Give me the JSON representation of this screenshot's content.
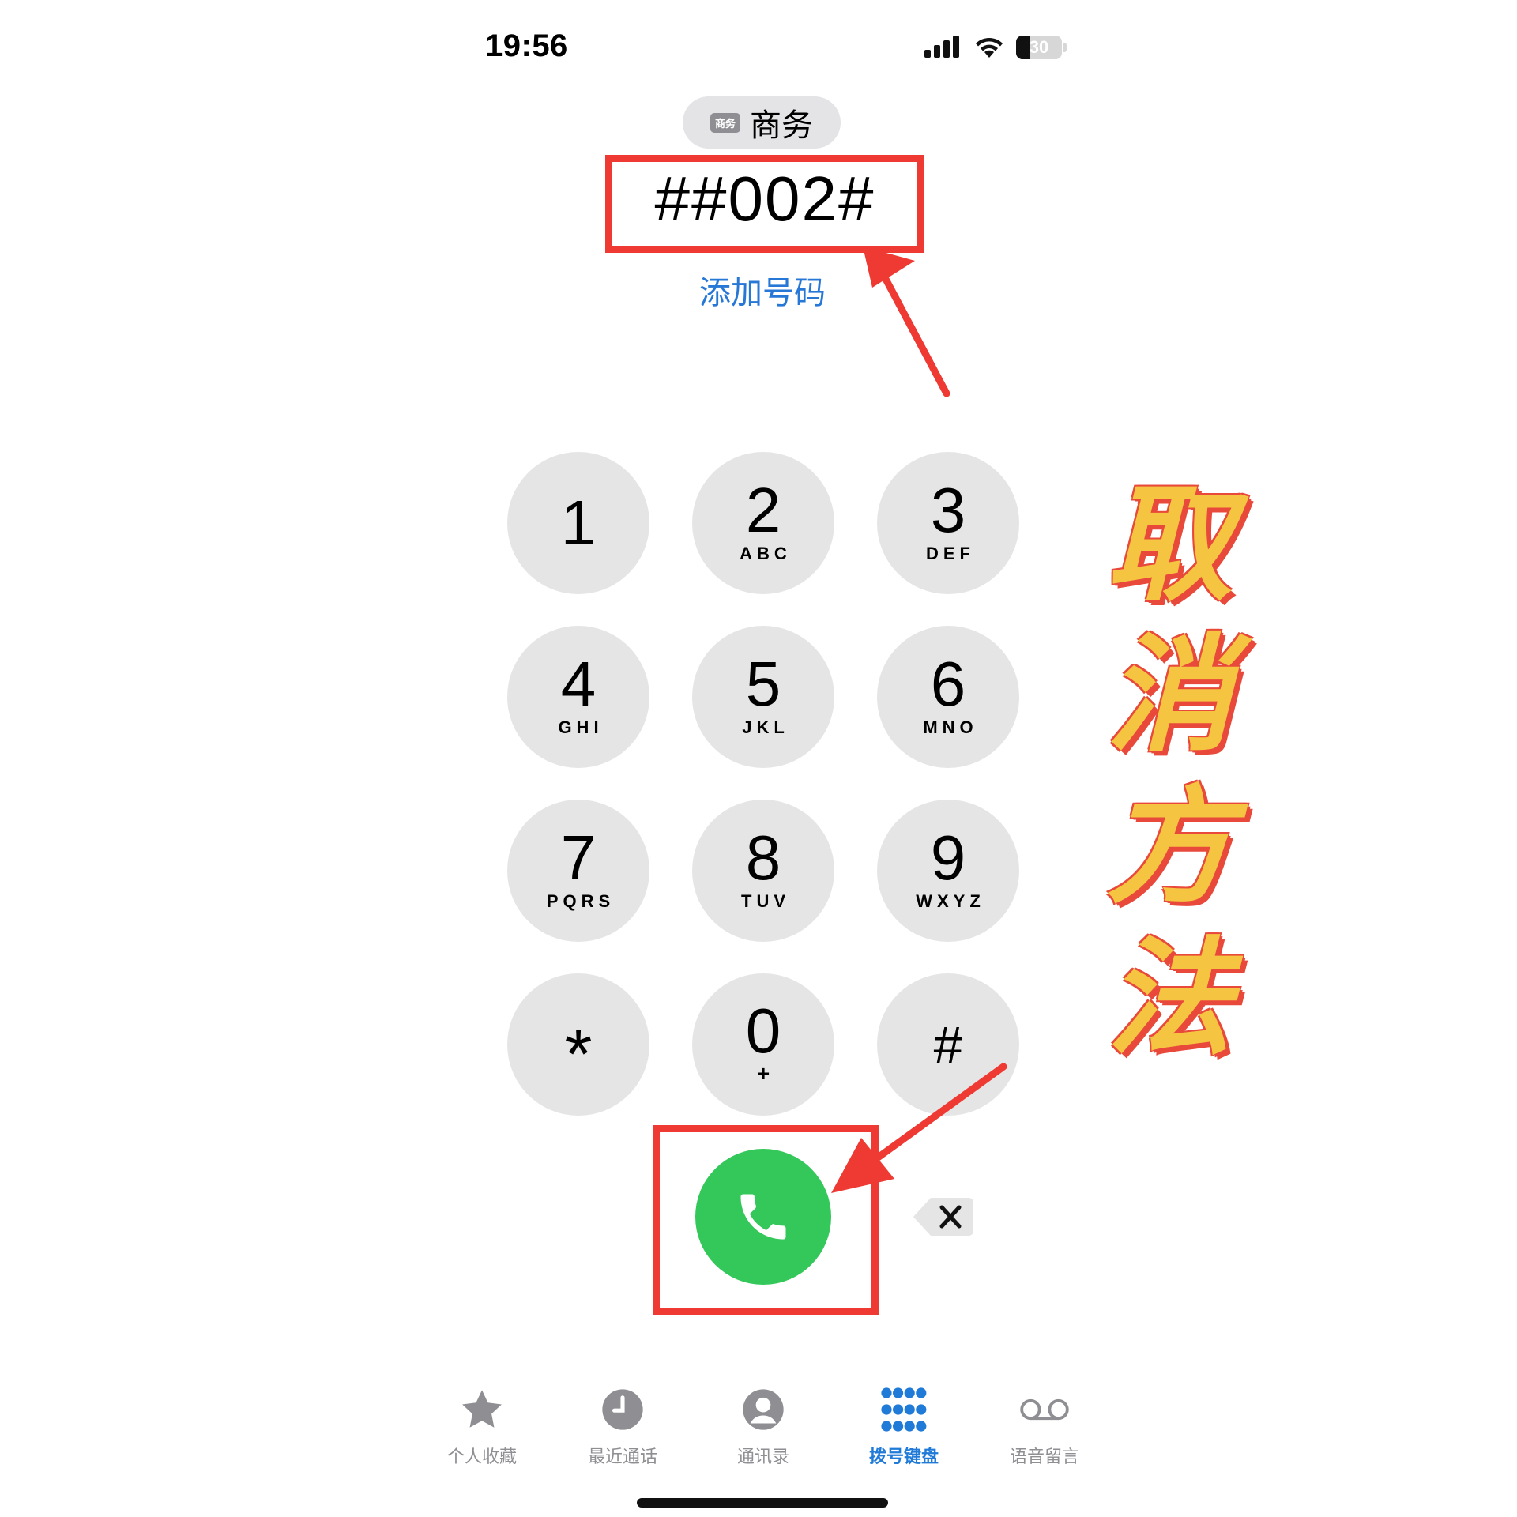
{
  "status_bar": {
    "time": "19:56",
    "battery_level": "30",
    "battery_fraction": 0.3
  },
  "line": {
    "badge": "商务",
    "name": "商务"
  },
  "dialed_number": "##002#",
  "add_number_label": "添加号码",
  "keypad": [
    {
      "digit": "1",
      "letters": ""
    },
    {
      "digit": "2",
      "letters": "ABC"
    },
    {
      "digit": "3",
      "letters": "DEF"
    },
    {
      "digit": "4",
      "letters": "GHI"
    },
    {
      "digit": "5",
      "letters": "JKL"
    },
    {
      "digit": "6",
      "letters": "MNO"
    },
    {
      "digit": "7",
      "letters": "PQRS"
    },
    {
      "digit": "8",
      "letters": "TUV"
    },
    {
      "digit": "9",
      "letters": "WXYZ"
    },
    {
      "digit": "*",
      "letters": ""
    },
    {
      "digit": "0",
      "letters": "+"
    },
    {
      "digit": "#",
      "letters": ""
    }
  ],
  "tabs": [
    {
      "label": "个人收藏",
      "icon": "star-icon"
    },
    {
      "label": "最近通话",
      "icon": "clock-icon"
    },
    {
      "label": "通讯录",
      "icon": "contact-icon"
    },
    {
      "label": "拨号键盘",
      "icon": "keypad-icon",
      "active": true
    },
    {
      "label": "语音留言",
      "icon": "voicemail-icon"
    }
  ],
  "overlay_caption": [
    "取",
    "消",
    "方",
    "法"
  ],
  "colors": {
    "key_bg": "#e5e5e6",
    "call_green": "#34c759",
    "link_blue": "#2777d6",
    "active_tab_blue": "#1f7ad8",
    "annotation_red": "#ee3a33",
    "caption_yellow": "#f5c542"
  }
}
